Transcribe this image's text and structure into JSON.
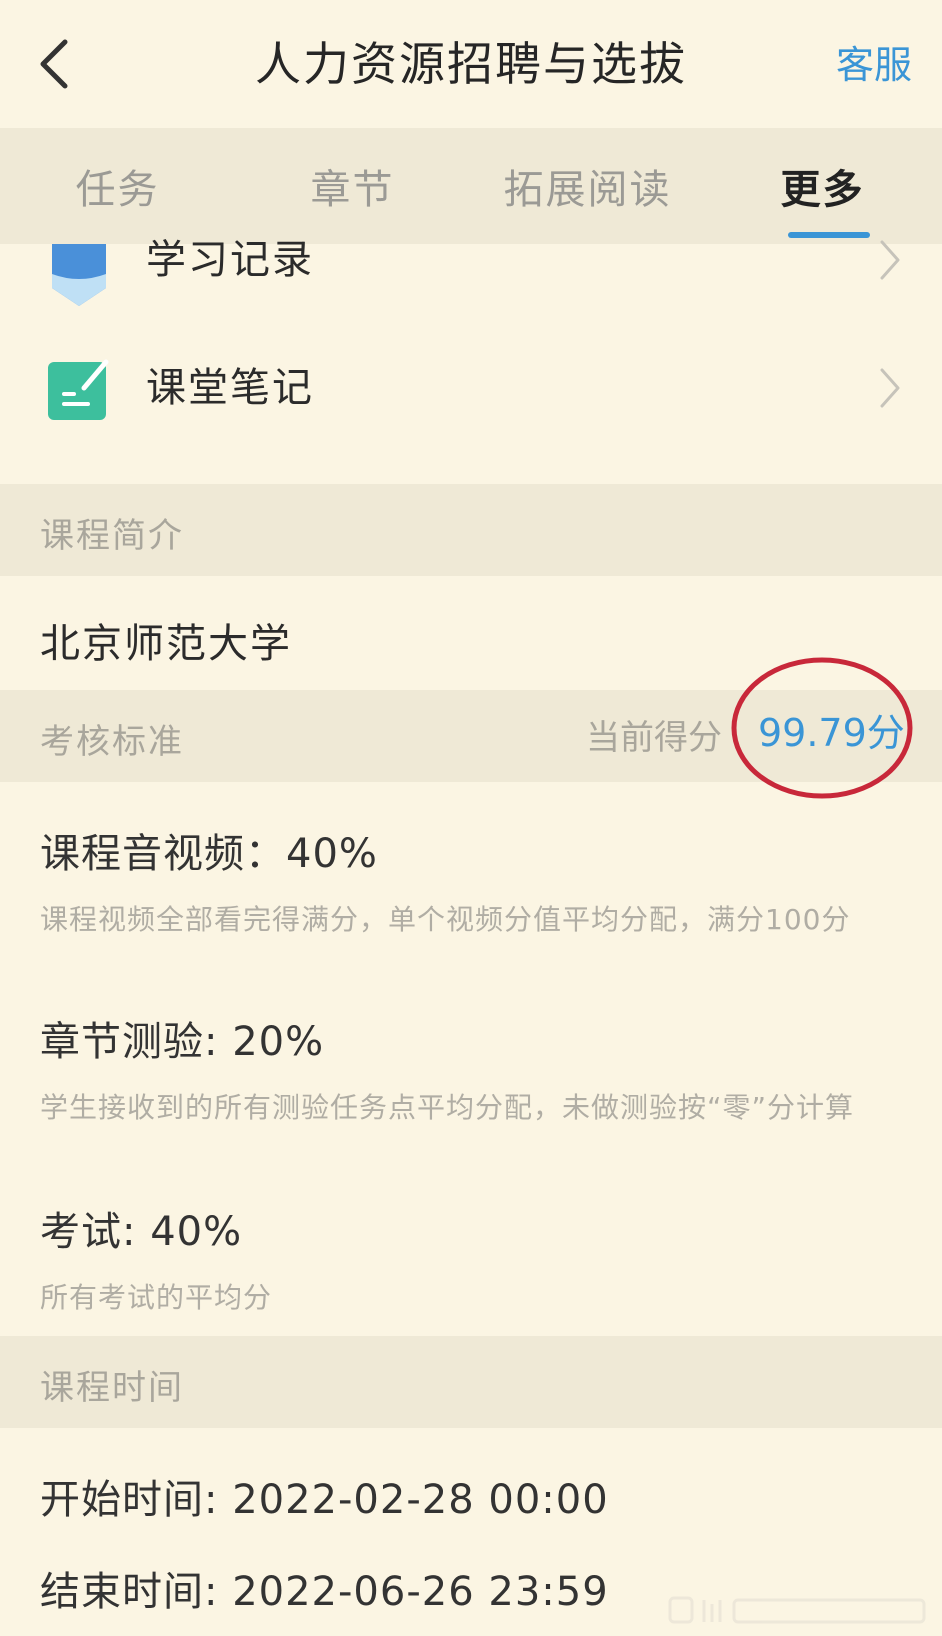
{
  "header": {
    "title": "人力资源招聘与选拔",
    "service_label": "客服"
  },
  "tabs": [
    {
      "label": "任务",
      "active": false
    },
    {
      "label": "章节",
      "active": false
    },
    {
      "label": "拓展阅读",
      "active": false
    },
    {
      "label": "更多",
      "active": true
    }
  ],
  "menu": {
    "study_record": "学习记录",
    "class_notes": "课堂笔记"
  },
  "intro": {
    "section_title": "课程简介",
    "school": "北京师范大学"
  },
  "assessment": {
    "section_title": "考核标准",
    "score_label": "当前得分",
    "score_value": "99.79分",
    "criteria": [
      {
        "title": "课程音视频：40%",
        "desc": "课程视频全部看完得满分，单个视频分值平均分配，满分100分"
      },
      {
        "title": "章节测验: 20%",
        "desc": "学生接收到的所有测验任务点平均分配，未做测验按“零”分计算"
      },
      {
        "title": "考试: 40%",
        "desc": "所有考试的平均分"
      }
    ]
  },
  "schedule": {
    "section_title": "课程时间",
    "start": "开始时间: 2022-02-28 00:00",
    "end": "结束时间: 2022-06-26 23:59"
  },
  "colors": {
    "background": "#fbf5e3",
    "accent": "#3a95d6",
    "annotation": "#c8283a"
  }
}
